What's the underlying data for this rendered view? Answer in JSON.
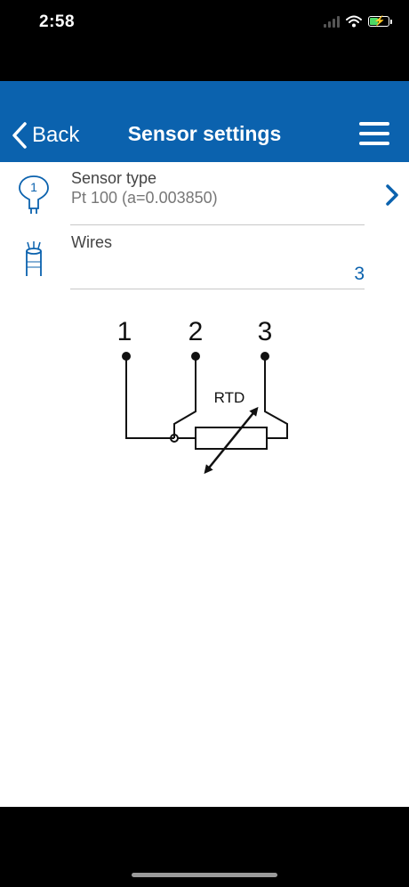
{
  "status_bar": {
    "time": "2:58",
    "icons": [
      "signal-icon",
      "wifi-icon",
      "battery-charging-icon"
    ],
    "battery_level": 0.45
  },
  "nav": {
    "back_label": "Back",
    "title": "Sensor settings",
    "menu_icon": "hamburger-menu-icon"
  },
  "settings": {
    "sensor_type": {
      "title": "Sensor type",
      "value": "Pt 100 (a=0.003850)",
      "icon": "sensor-probe-icon",
      "icon_text": "1"
    },
    "wires": {
      "title": "Wires",
      "value": "3",
      "icon": "wires-icon"
    }
  },
  "diagram": {
    "terminal_labels": [
      "1",
      "2",
      "3"
    ],
    "component_label": "RTD"
  },
  "colors": {
    "nav_background": "#0b62ae",
    "accent": "#0b62ae",
    "battery_fill": "#4cd964"
  }
}
